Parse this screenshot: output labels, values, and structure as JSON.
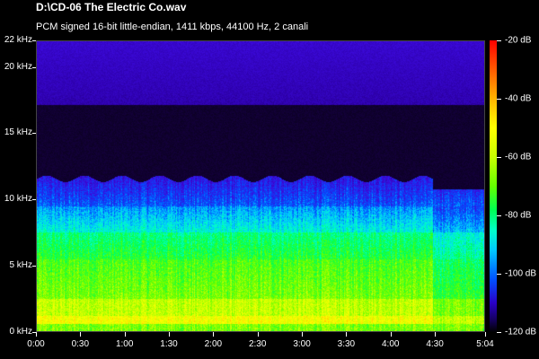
{
  "window": {
    "title": "D:\\CD-06  The Electric Co.wav",
    "subtitle": "PCM signed 16-bit little-endian, 1411 kbps, 44100 Hz, 2 canali"
  },
  "y_axis": {
    "labels": [
      "22 kHz",
      "20 kHz",
      "15 kHz",
      "10 kHz",
      "5 kHz",
      "0 kHz"
    ],
    "values_khz": [
      22,
      20,
      15,
      10,
      5,
      0
    ],
    "max_khz": 22
  },
  "x_axis": {
    "labels": [
      "0:00",
      "0:30",
      "1:00",
      "1:30",
      "2:00",
      "2:30",
      "3:00",
      "3:30",
      "4:00",
      "4:30",
      "5:04"
    ],
    "values_sec": [
      0,
      30,
      60,
      90,
      120,
      150,
      180,
      210,
      240,
      270,
      304
    ],
    "max_sec": 304
  },
  "color_scale": {
    "labels": [
      "-20 dB",
      "-40 dB",
      "-60 dB",
      "-80 dB",
      "-100 dB",
      "-120 dB"
    ],
    "values_db": [
      -20,
      -40,
      -60,
      -80,
      -100,
      -120
    ],
    "min_db": -120,
    "max_db": -20
  }
}
